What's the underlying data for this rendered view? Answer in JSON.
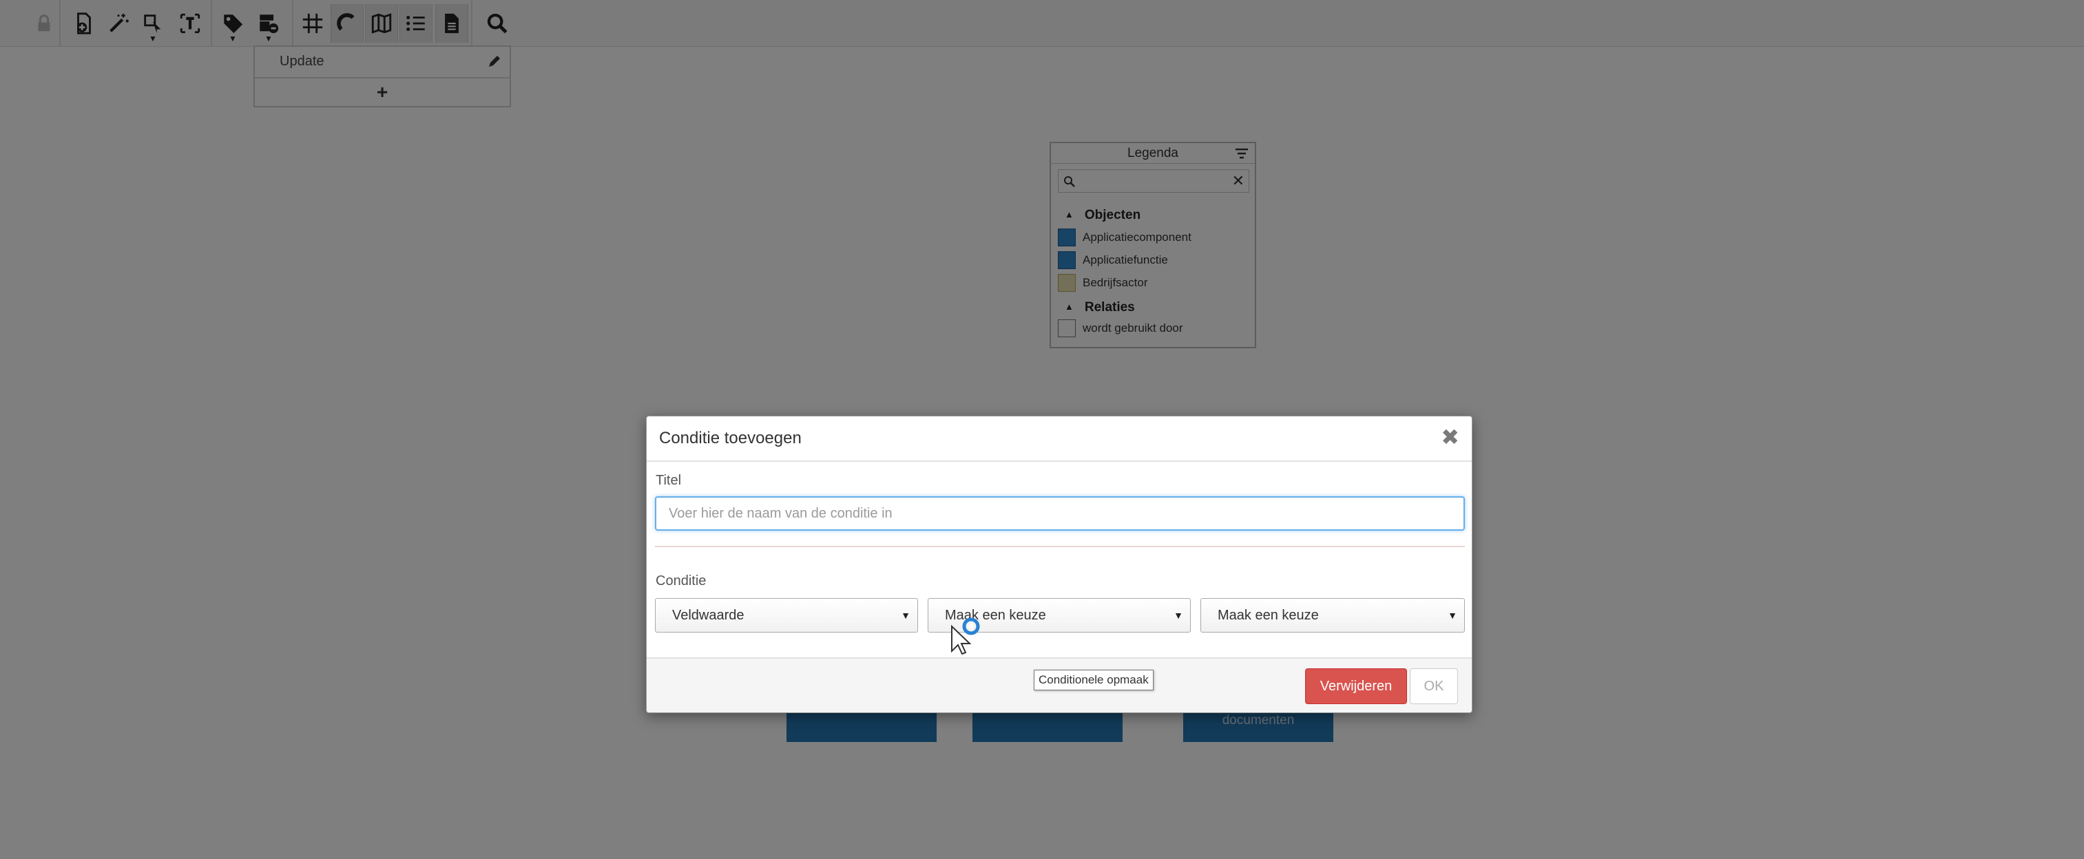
{
  "toolbar": {
    "buttons": [
      {
        "icon": "lock-icon"
      },
      {
        "icon": "add-document-icon"
      },
      {
        "icon": "magic-wand-icon"
      },
      {
        "icon": "select-shapes-icon"
      },
      {
        "icon": "text-frame-icon"
      },
      {
        "icon": "tag-icon"
      },
      {
        "icon": "conditional-format-icon"
      },
      {
        "icon": "grid-icon"
      },
      {
        "icon": "magnet-icon"
      },
      {
        "icon": "map-icon"
      },
      {
        "icon": "list-icon"
      },
      {
        "icon": "document-icon"
      },
      {
        "icon": "search-icon"
      }
    ]
  },
  "update_panel": {
    "label": "Update",
    "add_label": "+"
  },
  "legend": {
    "title": "Legenda",
    "search_clear": "✕",
    "sections": [
      {
        "title": "Objecten",
        "items": [
          {
            "label": "Applicatiecomponent",
            "swatch": "#2f86c8"
          },
          {
            "label": "Applicatiefunctie",
            "swatch": "#2f86c8"
          },
          {
            "label": "Bedrijfsactor",
            "swatch": "#e7dfb0"
          }
        ]
      },
      {
        "title": "Relaties",
        "items": [
          {
            "label": "wordt gebruikt door",
            "swatch": "#ffffff"
          }
        ]
      }
    ]
  },
  "background": {
    "box3_text": "documenten"
  },
  "modal": {
    "title": "Conditie toevoegen",
    "close_symbol": "✖",
    "title_field_label": "Titel",
    "title_placeholder": "Voer hier de naam van de conditie in",
    "condition_label": "Conditie",
    "select1_value": "Veldwaarde",
    "select2_value": "Maak een keuze",
    "select3_value": "Maak een keuze",
    "tooltip": "Conditionele opmaak",
    "delete_label": "Verwijderen",
    "ok_label": "OK"
  },
  "colors": {
    "accent_blue": "#2477b3",
    "danger_red": "#d9534f",
    "focus_blue": "#66afe9"
  }
}
